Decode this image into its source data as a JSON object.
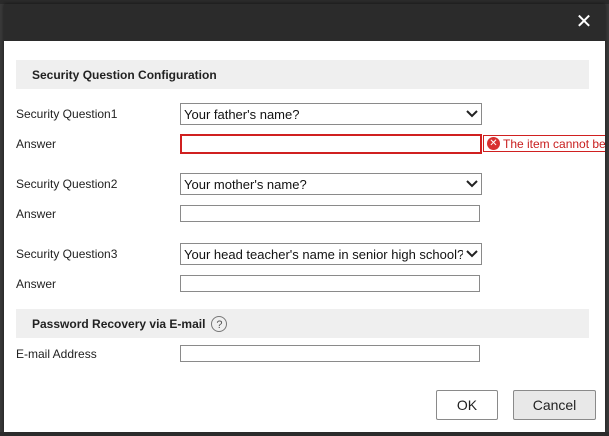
{
  "dialog": {
    "close_glyph": "✕"
  },
  "security_section": {
    "title": "Security Question Configuration",
    "questions": [
      {
        "label": "Security Question1",
        "selected": "Your father's name?",
        "answer_label": "Answer",
        "answer_value": "",
        "error": "The item cannot be empty."
      },
      {
        "label": "Security Question2",
        "selected": "Your mother's name?",
        "answer_label": "Answer",
        "answer_value": ""
      },
      {
        "label": "Security Question3",
        "selected": "Your head teacher's name in senior high school?",
        "answer_label": "Answer",
        "answer_value": ""
      }
    ]
  },
  "recovery_section": {
    "title": "Password Recovery via E-mail",
    "help_glyph": "?",
    "email_label": "E-mail Address",
    "email_value": ""
  },
  "buttons": {
    "ok": "OK",
    "cancel": "Cancel"
  },
  "colors": {
    "titlebar": "#2b2b2b",
    "error": "#d02020",
    "section_bg": "#efefef"
  }
}
